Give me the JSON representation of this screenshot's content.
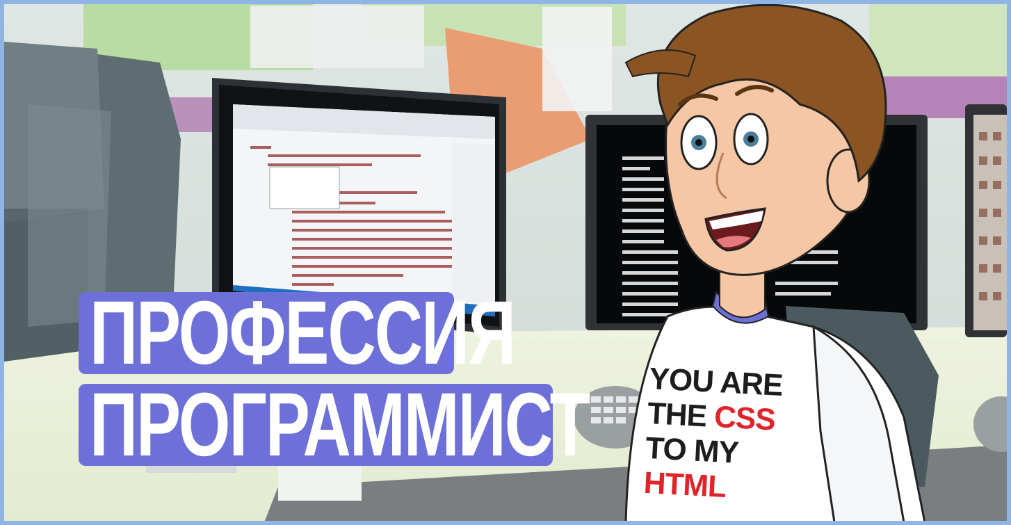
{
  "title": {
    "line1": "ПРОФЕССИЯ",
    "line2": "ПРОГРАММИСТ"
  },
  "shirt": {
    "line1": "YOU ARE",
    "line2_a": "THE ",
    "line2_b": "CSS",
    "line3": "TO MY",
    "line4": "HTML"
  },
  "colors": {
    "banner": "#6c70d8",
    "shirt_red": "#e0242a",
    "border": "#8fb4e6"
  }
}
